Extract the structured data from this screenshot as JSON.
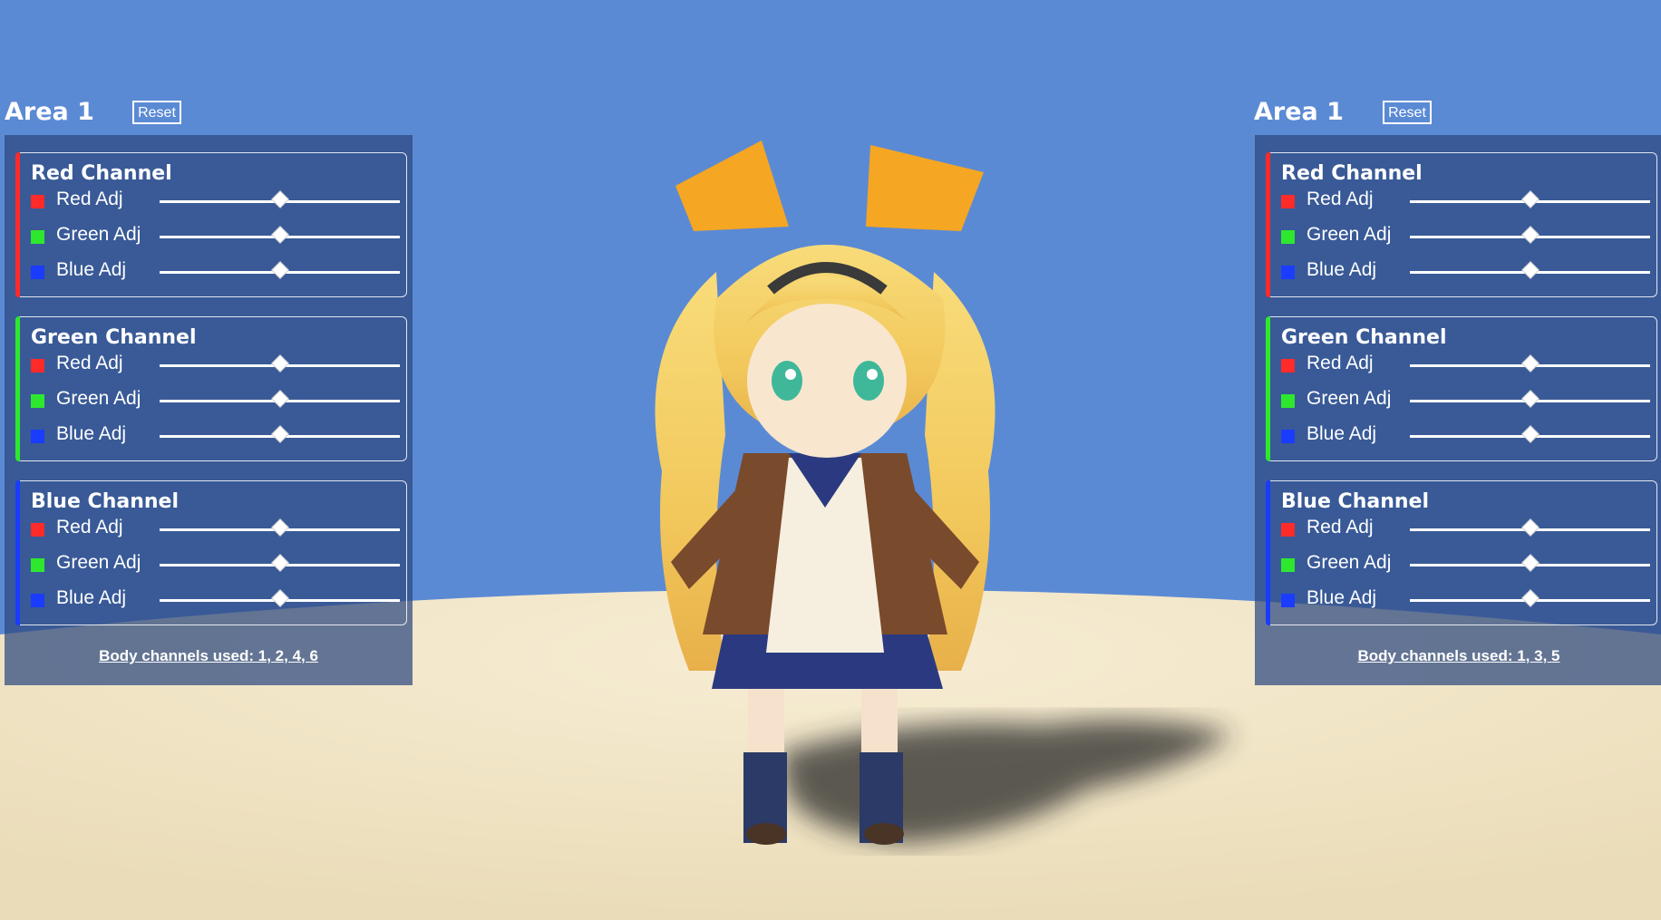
{
  "colors": {
    "sky": "#5b8ad4",
    "ground": "#f2e6c8",
    "red": "#ff2a2a",
    "green": "#2ee82e",
    "blue": "#1a3cff",
    "panel_bg": "rgba(44,72,128,0.72)"
  },
  "left_panel": {
    "title": "Area 1",
    "reset_label": "Reset",
    "groups": [
      {
        "title": "Red Channel",
        "accent": "red",
        "rows": [
          {
            "label": "Red Adj",
            "swatch": "red",
            "value": 0.5
          },
          {
            "label": "Green Adj",
            "swatch": "green",
            "value": 0.5
          },
          {
            "label": "Blue Adj",
            "swatch": "blue",
            "value": 0.5
          }
        ]
      },
      {
        "title": "Green Channel",
        "accent": "green",
        "rows": [
          {
            "label": "Red Adj",
            "swatch": "red",
            "value": 0.5
          },
          {
            "label": "Green Adj",
            "swatch": "green",
            "value": 0.5
          },
          {
            "label": "Blue Adj",
            "swatch": "blue",
            "value": 0.5
          }
        ]
      },
      {
        "title": "Blue Channel",
        "accent": "blue",
        "rows": [
          {
            "label": "Red Adj",
            "swatch": "red",
            "value": 0.5
          },
          {
            "label": "Green Adj",
            "swatch": "green",
            "value": 0.5
          },
          {
            "label": "Blue Adj",
            "swatch": "blue",
            "value": 0.5
          }
        ]
      }
    ],
    "footer": "Body channels used: 1, 2, 4, 6"
  },
  "right_panel": {
    "title": "Area 1",
    "reset_label": "Reset",
    "groups": [
      {
        "title": "Red Channel",
        "accent": "red",
        "rows": [
          {
            "label": "Red Adj",
            "swatch": "red",
            "value": 0.5
          },
          {
            "label": "Green Adj",
            "swatch": "green",
            "value": 0.5
          },
          {
            "label": "Blue Adj",
            "swatch": "blue",
            "value": 0.5
          }
        ]
      },
      {
        "title": "Green Channel",
        "accent": "green",
        "rows": [
          {
            "label": "Red Adj",
            "swatch": "red",
            "value": 0.5
          },
          {
            "label": "Green Adj",
            "swatch": "green",
            "value": 0.5
          },
          {
            "label": "Blue Adj",
            "swatch": "blue",
            "value": 0.5
          }
        ]
      },
      {
        "title": "Blue Channel",
        "accent": "blue",
        "rows": [
          {
            "label": "Red Adj",
            "swatch": "red",
            "value": 0.5
          },
          {
            "label": "Green Adj",
            "swatch": "green",
            "value": 0.5
          },
          {
            "label": "Blue Adj",
            "swatch": "blue",
            "value": 0.5
          }
        ]
      }
    ],
    "footer": "Body channels used: 1, 3, 5"
  }
}
